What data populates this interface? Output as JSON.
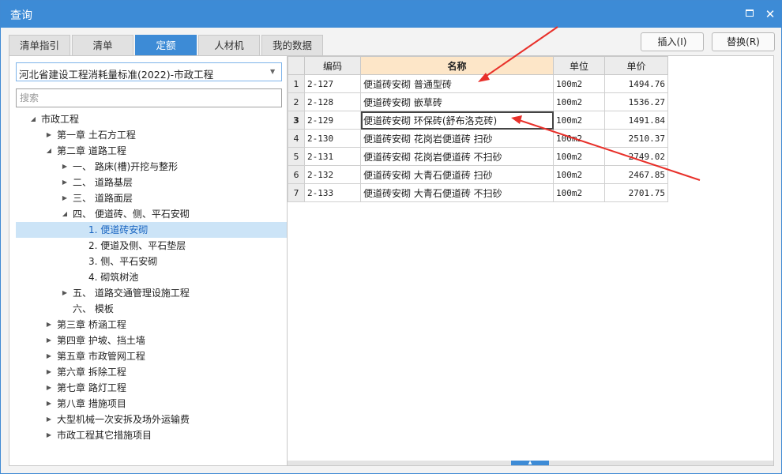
{
  "window": {
    "title": "查询",
    "max_icon": "maximize-icon",
    "close_glyph": "✕"
  },
  "tabs": [
    {
      "label": "清单指引",
      "active": false
    },
    {
      "label": "清单",
      "active": false
    },
    {
      "label": "定额",
      "active": true
    },
    {
      "label": "人材机",
      "active": false
    },
    {
      "label": "我的数据",
      "active": false
    }
  ],
  "buttons": {
    "insert": "插入(I)",
    "replace": "替换(R)"
  },
  "left": {
    "combo_value": "河北省建设工程消耗量标准(2022)-市政工程",
    "search_placeholder": "搜索",
    "tree": [
      {
        "label": "市政工程",
        "level": 0,
        "toggle": "expanded"
      },
      {
        "label": "第一章 土石方工程",
        "level": 1,
        "toggle": "collapsed"
      },
      {
        "label": "第二章 道路工程",
        "level": 1,
        "toggle": "expanded"
      },
      {
        "label": "一、 路床(槽)开挖与整形",
        "level": 2,
        "toggle": "collapsed"
      },
      {
        "label": "二、 道路基层",
        "level": 2,
        "toggle": "collapsed"
      },
      {
        "label": "三、 道路面层",
        "level": 2,
        "toggle": "collapsed"
      },
      {
        "label": "四、 便道砖、侧、平石安砌",
        "level": 2,
        "toggle": "expanded"
      },
      {
        "label": "1. 便道砖安砌",
        "level": 3,
        "toggle": "none",
        "selected": true
      },
      {
        "label": "2. 便道及侧、平石垫层",
        "level": 3,
        "toggle": "none"
      },
      {
        "label": "3. 侧、平石安砌",
        "level": 3,
        "toggle": "none"
      },
      {
        "label": "4. 砌筑树池",
        "level": 3,
        "toggle": "none"
      },
      {
        "label": "五、 道路交通管理设施工程",
        "level": 2,
        "toggle": "collapsed"
      },
      {
        "label": "六、 模板",
        "level": 2,
        "toggle": "none"
      },
      {
        "label": "第三章 桥涵工程",
        "level": 1,
        "toggle": "collapsed"
      },
      {
        "label": "第四章 护坡、挡土墙",
        "level": 1,
        "toggle": "collapsed"
      },
      {
        "label": "第五章 市政管网工程",
        "level": 1,
        "toggle": "collapsed"
      },
      {
        "label": "第六章 拆除工程",
        "level": 1,
        "toggle": "collapsed"
      },
      {
        "label": "第七章 路灯工程",
        "level": 1,
        "toggle": "collapsed"
      },
      {
        "label": "第八章 措施项目",
        "level": 1,
        "toggle": "collapsed"
      },
      {
        "label": "大型机械一次安拆及场外运输费",
        "level": 1,
        "toggle": "collapsed"
      },
      {
        "label": "市政工程其它措施项目",
        "level": 1,
        "toggle": "collapsed"
      }
    ]
  },
  "grid": {
    "headers": {
      "code": "编码",
      "name": "名称",
      "unit": "单位",
      "price": "单价"
    },
    "rows": [
      {
        "n": "1",
        "code": "2-127",
        "name": "便道砖安砌 普通型砖",
        "unit": "100m2",
        "price": "1494.76"
      },
      {
        "n": "2",
        "code": "2-128",
        "name": "便道砖安砌 嵌草砖",
        "unit": "100m2",
        "price": "1536.27"
      },
      {
        "n": "3",
        "code": "2-129",
        "name": "便道砖安砌 环保砖(舒布洛克砖)",
        "unit": "100m2",
        "price": "1491.84",
        "current": true
      },
      {
        "n": "4",
        "code": "2-130",
        "name": "便道砖安砌 花岗岩便道砖 扫砂",
        "unit": "100m2",
        "price": "2510.37"
      },
      {
        "n": "5",
        "code": "2-131",
        "name": "便道砖安砌 花岗岩便道砖 不扫砂",
        "unit": "100m2",
        "price": "2749.02"
      },
      {
        "n": "6",
        "code": "2-132",
        "name": "便道砖安砌 大青石便道砖 扫砂",
        "unit": "100m2",
        "price": "2467.85"
      },
      {
        "n": "7",
        "code": "2-133",
        "name": "便道砖安砌 大青石便道砖 不扫砂",
        "unit": "100m2",
        "price": "2701.75"
      }
    ]
  },
  "colors": {
    "accent": "#3d8bd6",
    "annotation_arrow": "#e8302a",
    "header_highlight": "#fde6c8"
  }
}
